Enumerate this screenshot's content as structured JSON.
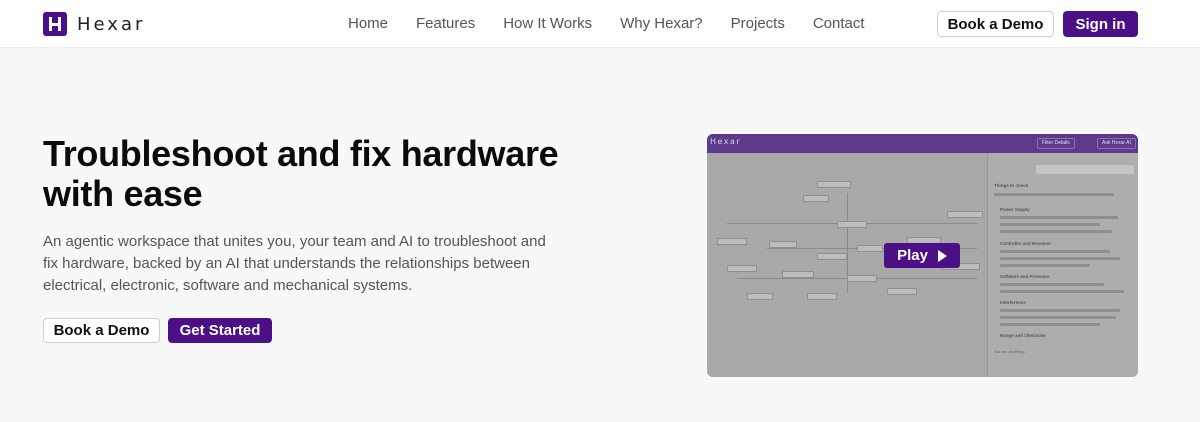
{
  "header": {
    "brand": "Hexar",
    "nav": [
      "Home",
      "Features",
      "How It Works",
      "Why Hexar?",
      "Projects",
      "Contact"
    ],
    "book_demo": "Book a Demo",
    "sign_in": "Sign in"
  },
  "hero": {
    "title": "Troubleshoot and fix hardware with ease",
    "description": "An agentic workspace that unites you, your team and AI to troubleshoot and fix hardware, backed by an AI that understands the relationships between electrical, electronic, software and mechanical systems.",
    "book_demo": "Book a Demo",
    "get_started": "Get Started"
  },
  "preview": {
    "brand": "Hexar",
    "play_label": "Play",
    "filter_label": "Filter Details",
    "ask_label": "Ask Hexar AI",
    "things_to_check": "Things to check",
    "sections": [
      "Power Supply",
      "Controller and Receiver",
      "Software and Firmware",
      "Interference",
      "Range and Obstacles"
    ],
    "input_placeholder": "Ask me anything..."
  },
  "colors": {
    "brand": "#4b0f86",
    "preview_bar": "#5e3a8a"
  }
}
